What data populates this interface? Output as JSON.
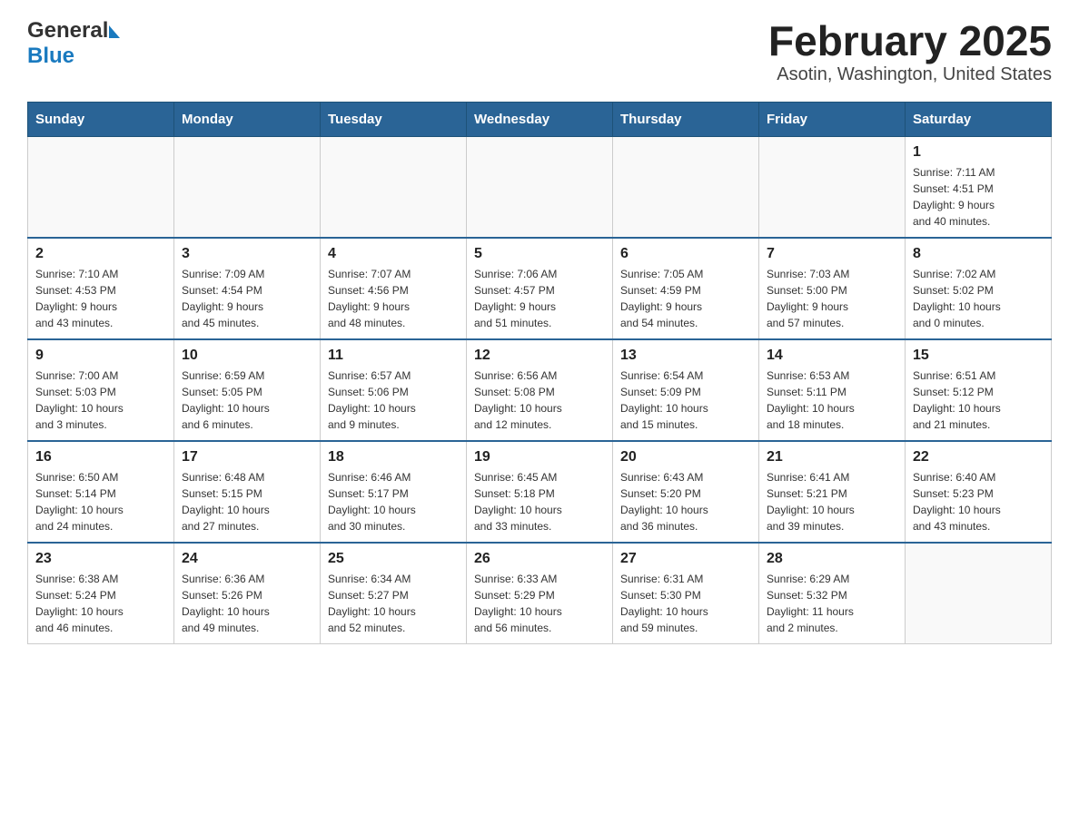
{
  "header": {
    "logo_general": "General",
    "logo_blue": "Blue",
    "title": "February 2025",
    "subtitle": "Asotin, Washington, United States"
  },
  "calendar": {
    "days_of_week": [
      "Sunday",
      "Monday",
      "Tuesday",
      "Wednesday",
      "Thursday",
      "Friday",
      "Saturday"
    ],
    "weeks": [
      [
        {
          "day": "",
          "info": ""
        },
        {
          "day": "",
          "info": ""
        },
        {
          "day": "",
          "info": ""
        },
        {
          "day": "",
          "info": ""
        },
        {
          "day": "",
          "info": ""
        },
        {
          "day": "",
          "info": ""
        },
        {
          "day": "1",
          "info": "Sunrise: 7:11 AM\nSunset: 4:51 PM\nDaylight: 9 hours\nand 40 minutes."
        }
      ],
      [
        {
          "day": "2",
          "info": "Sunrise: 7:10 AM\nSunset: 4:53 PM\nDaylight: 9 hours\nand 43 minutes."
        },
        {
          "day": "3",
          "info": "Sunrise: 7:09 AM\nSunset: 4:54 PM\nDaylight: 9 hours\nand 45 minutes."
        },
        {
          "day": "4",
          "info": "Sunrise: 7:07 AM\nSunset: 4:56 PM\nDaylight: 9 hours\nand 48 minutes."
        },
        {
          "day": "5",
          "info": "Sunrise: 7:06 AM\nSunset: 4:57 PM\nDaylight: 9 hours\nand 51 minutes."
        },
        {
          "day": "6",
          "info": "Sunrise: 7:05 AM\nSunset: 4:59 PM\nDaylight: 9 hours\nand 54 minutes."
        },
        {
          "day": "7",
          "info": "Sunrise: 7:03 AM\nSunset: 5:00 PM\nDaylight: 9 hours\nand 57 minutes."
        },
        {
          "day": "8",
          "info": "Sunrise: 7:02 AM\nSunset: 5:02 PM\nDaylight: 10 hours\nand 0 minutes."
        }
      ],
      [
        {
          "day": "9",
          "info": "Sunrise: 7:00 AM\nSunset: 5:03 PM\nDaylight: 10 hours\nand 3 minutes."
        },
        {
          "day": "10",
          "info": "Sunrise: 6:59 AM\nSunset: 5:05 PM\nDaylight: 10 hours\nand 6 minutes."
        },
        {
          "day": "11",
          "info": "Sunrise: 6:57 AM\nSunset: 5:06 PM\nDaylight: 10 hours\nand 9 minutes."
        },
        {
          "day": "12",
          "info": "Sunrise: 6:56 AM\nSunset: 5:08 PM\nDaylight: 10 hours\nand 12 minutes."
        },
        {
          "day": "13",
          "info": "Sunrise: 6:54 AM\nSunset: 5:09 PM\nDaylight: 10 hours\nand 15 minutes."
        },
        {
          "day": "14",
          "info": "Sunrise: 6:53 AM\nSunset: 5:11 PM\nDaylight: 10 hours\nand 18 minutes."
        },
        {
          "day": "15",
          "info": "Sunrise: 6:51 AM\nSunset: 5:12 PM\nDaylight: 10 hours\nand 21 minutes."
        }
      ],
      [
        {
          "day": "16",
          "info": "Sunrise: 6:50 AM\nSunset: 5:14 PM\nDaylight: 10 hours\nand 24 minutes."
        },
        {
          "day": "17",
          "info": "Sunrise: 6:48 AM\nSunset: 5:15 PM\nDaylight: 10 hours\nand 27 minutes."
        },
        {
          "day": "18",
          "info": "Sunrise: 6:46 AM\nSunset: 5:17 PM\nDaylight: 10 hours\nand 30 minutes."
        },
        {
          "day": "19",
          "info": "Sunrise: 6:45 AM\nSunset: 5:18 PM\nDaylight: 10 hours\nand 33 minutes."
        },
        {
          "day": "20",
          "info": "Sunrise: 6:43 AM\nSunset: 5:20 PM\nDaylight: 10 hours\nand 36 minutes."
        },
        {
          "day": "21",
          "info": "Sunrise: 6:41 AM\nSunset: 5:21 PM\nDaylight: 10 hours\nand 39 minutes."
        },
        {
          "day": "22",
          "info": "Sunrise: 6:40 AM\nSunset: 5:23 PM\nDaylight: 10 hours\nand 43 minutes."
        }
      ],
      [
        {
          "day": "23",
          "info": "Sunrise: 6:38 AM\nSunset: 5:24 PM\nDaylight: 10 hours\nand 46 minutes."
        },
        {
          "day": "24",
          "info": "Sunrise: 6:36 AM\nSunset: 5:26 PM\nDaylight: 10 hours\nand 49 minutes."
        },
        {
          "day": "25",
          "info": "Sunrise: 6:34 AM\nSunset: 5:27 PM\nDaylight: 10 hours\nand 52 minutes."
        },
        {
          "day": "26",
          "info": "Sunrise: 6:33 AM\nSunset: 5:29 PM\nDaylight: 10 hours\nand 56 minutes."
        },
        {
          "day": "27",
          "info": "Sunrise: 6:31 AM\nSunset: 5:30 PM\nDaylight: 10 hours\nand 59 minutes."
        },
        {
          "day": "28",
          "info": "Sunrise: 6:29 AM\nSunset: 5:32 PM\nDaylight: 11 hours\nand 2 minutes."
        },
        {
          "day": "",
          "info": ""
        }
      ]
    ]
  }
}
